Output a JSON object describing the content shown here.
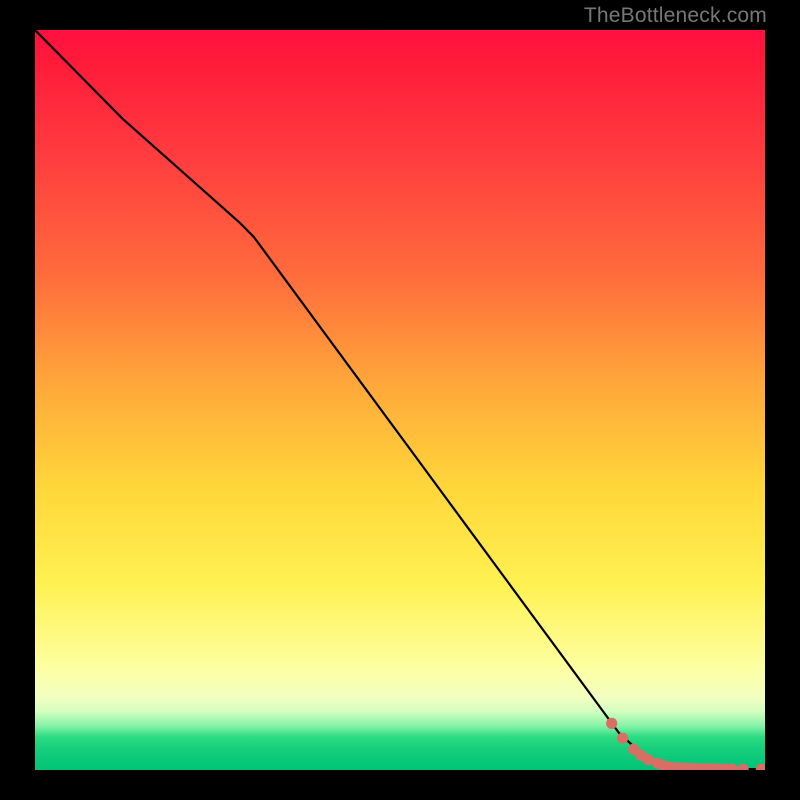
{
  "watermark": "TheBottleneck.com",
  "colors": {
    "background": "#000000",
    "line": "#000000",
    "marker_fill": "#da6e64",
    "marker_stroke": "#9f4d46"
  },
  "chart_data": {
    "type": "line",
    "title": "",
    "xlabel": "",
    "ylabel": "",
    "xlim": [
      0,
      100
    ],
    "ylim": [
      0,
      100
    ],
    "grid": false,
    "line_series": {
      "name": "bottleneck-curve",
      "x": [
        0,
        5,
        12,
        20,
        28,
        30,
        40,
        50,
        60,
        70,
        80,
        84,
        88,
        90,
        100
      ],
      "y": [
        100,
        95,
        88,
        81,
        74,
        72,
        58.6,
        45.2,
        31.8,
        18.4,
        5.0,
        1.4,
        0.3,
        0.15,
        0.1
      ]
    },
    "markers": {
      "name": "highlight-segment",
      "x": [
        79,
        80.5,
        82,
        83,
        84,
        85.3,
        86.2,
        87,
        88,
        88.8,
        89.5,
        90.2,
        91,
        91.8,
        92.6,
        93.5,
        94.5,
        95.5,
        97,
        99.5
      ],
      "y": [
        6.3,
        4.3,
        2.8,
        2.0,
        1.4,
        0.9,
        0.55,
        0.4,
        0.3,
        0.26,
        0.22,
        0.2,
        0.18,
        0.17,
        0.16,
        0.15,
        0.14,
        0.12,
        0.1,
        0.1
      ]
    }
  }
}
